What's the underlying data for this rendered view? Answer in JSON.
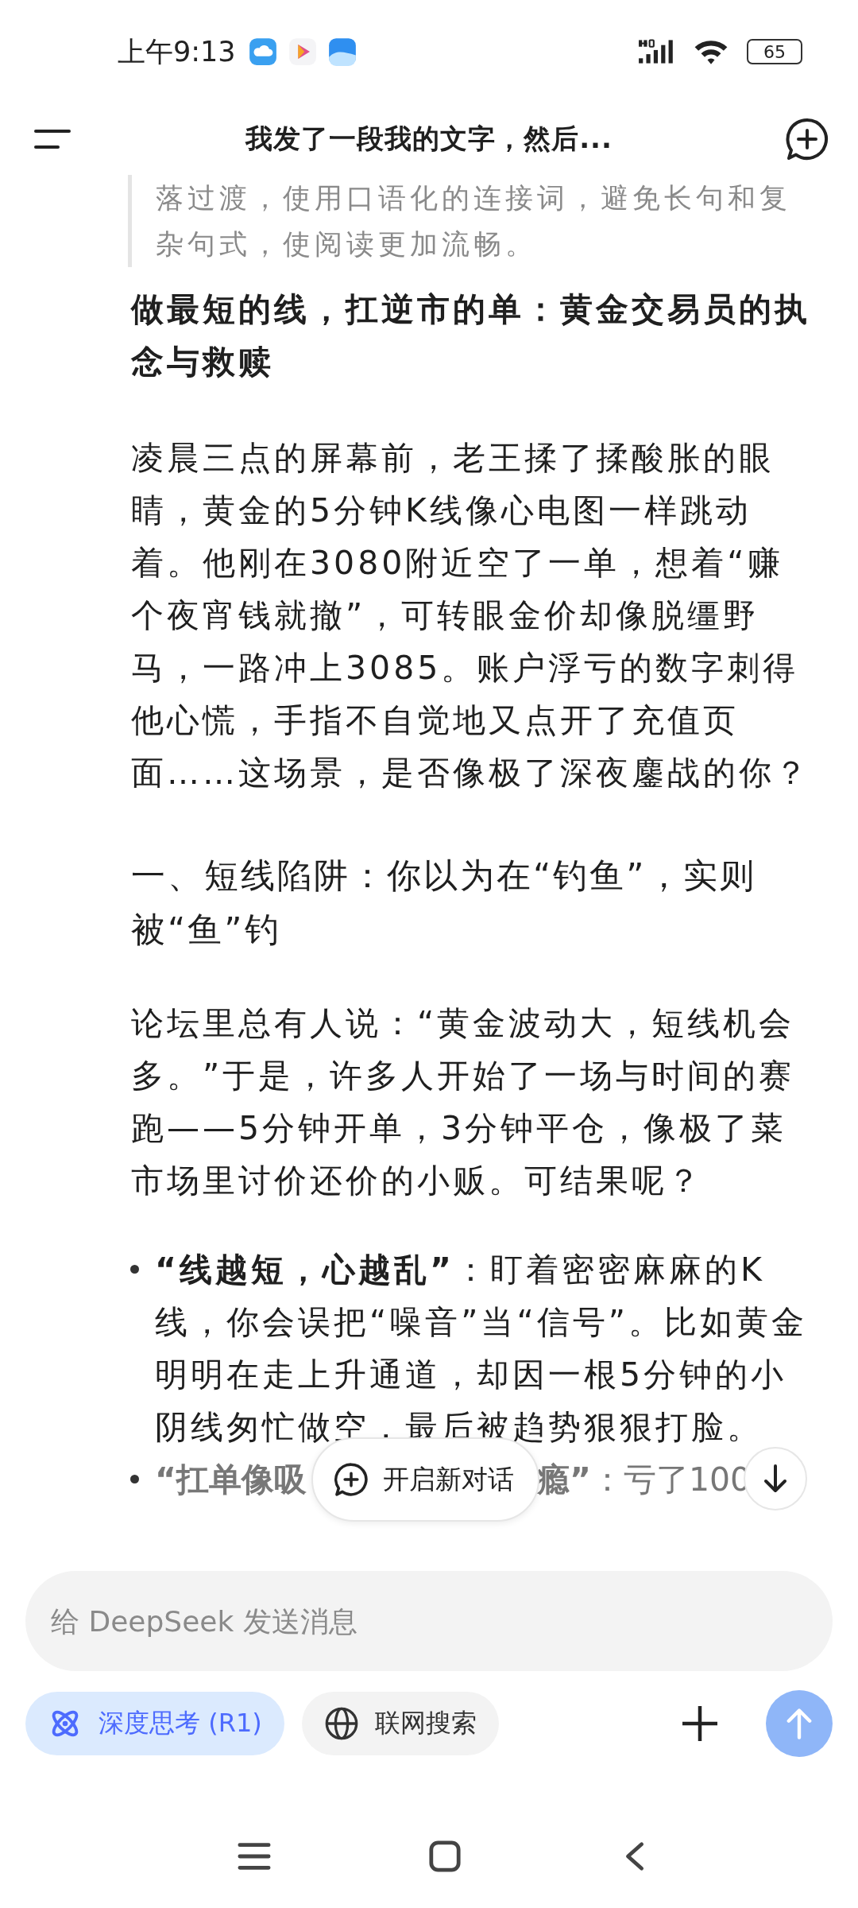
{
  "status_bar": {
    "time": "上午9:13",
    "battery": "65"
  },
  "header": {
    "title": "我发了一段我的文字，然后..."
  },
  "quote": "落过渡，使用口语化的连接词，避免长句和复杂句式，使阅读更加流畅。",
  "blocks": [
    {
      "kind": "heading",
      "text": "做最短的线，扛逆市的单：黄金交易员的执念与救赎"
    },
    {
      "kind": "paragraph",
      "text": "凌晨三点的屏幕前，老王揉了揉酸胀的眼睛，黄金的5分钟K线像心电图一样跳动着。他刚在3080附近空了一单，想着“赚个夜宵钱就撤”，可转眼金价却像脱缰野马，一路冲上3085。账户浮亏的数字刺得他心慌，手指不自觉地又点开了充值页面……这场景，是否像极了深夜鏖战的你？"
    },
    {
      "kind": "section",
      "text": "一、短线陷阱：你以为在“钓鱼”，实则被“鱼”钓"
    },
    {
      "kind": "paragraph",
      "text": "论坛里总有人说：“黄金波动大，短线机会多。”于是，许多人开始了一场与时间的赛跑——5分钟开单，3分钟平仓，像极了菜市场里讨价还价的小贩。可结果呢？"
    },
    {
      "kind": "bullet",
      "text": "**“线越短，心越乱”**：盯着密密麻麻的K线，你会误把“噪音”当“信号”。比如黄金明明在走上升通道，却因一根5分钟的小阴线匆忙做空，最后被趋势狠狠打脸。"
    },
    {
      "kind": "bullet_cut",
      "before": "**“扛单像吸**",
      "after": "**瘾”**：亏了100"
    }
  ],
  "new_chat_button": "开启新对话",
  "input": {
    "placeholder": "给 DeepSeek 发送消息"
  },
  "toggles": [
    {
      "kind": "think",
      "label": "深度思考 (R1)",
      "selected": true
    },
    {
      "kind": "web",
      "label": "联网搜索",
      "selected": false
    }
  ]
}
